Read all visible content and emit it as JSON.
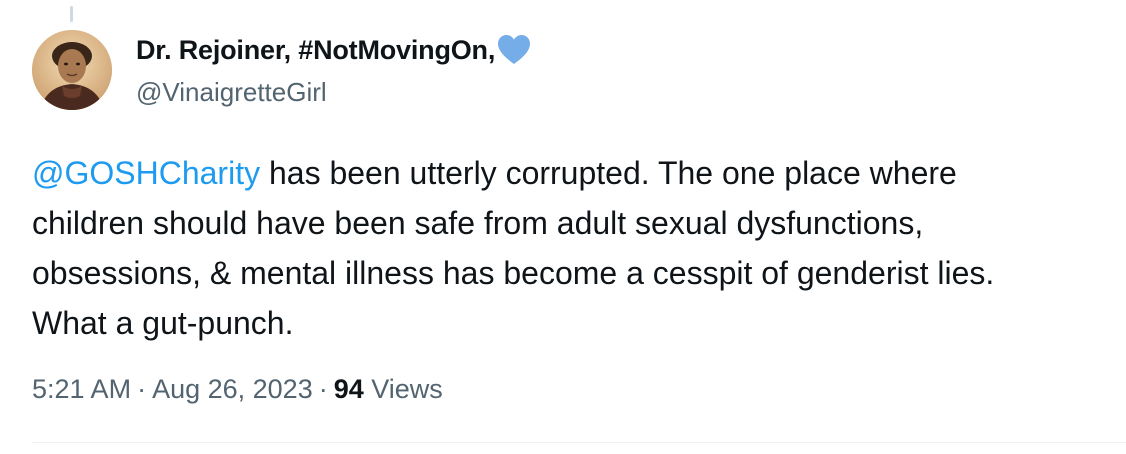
{
  "author": {
    "display_name": "Dr. Rejoiner, #NotMovingOn,",
    "handle": "@VinaigretteGirl",
    "emoji_icon": "blue-heart-icon",
    "emoji_color": "#74ADE8"
  },
  "tweet": {
    "mention": "@GOSHCharity",
    "line1_rest": " has been utterly corrupted. The one place where",
    "line2": "children should have been safe from adult sexual dysfunctions,",
    "line3": "obsessions, & mental illness has become a cesspit of genderist lies.",
    "line4": "What a gut-punch."
  },
  "meta": {
    "time": "5:21 AM",
    "separator": "·",
    "date": "Aug 26, 2023",
    "views_count": "94",
    "views_label": " Views"
  },
  "colors": {
    "link": "#1d9bf0",
    "text": "#0f1419",
    "secondary": "#536471",
    "divider": "#eff3f4"
  }
}
